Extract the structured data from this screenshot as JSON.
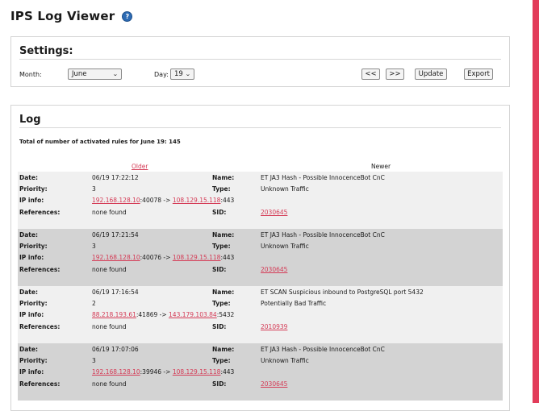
{
  "app": {
    "title": "IPS Log Viewer",
    "help_icon": "?"
  },
  "settings": {
    "title": "Settings:",
    "month_label": "Month:",
    "month_value": "June",
    "day_label": "Day:",
    "day_value": "19",
    "prev_button": "<<",
    "next_button": ">>",
    "update_button": "Update",
    "export_button": "Export"
  },
  "log": {
    "title": "Log",
    "total": "Total of number of activated rules for June 19: 145",
    "older_link": "Older",
    "newer_label": "Newer",
    "labels": {
      "date": "Date:",
      "priority": "Priority:",
      "ip_info": "IP info:",
      "references": "References:",
      "name": "Name:",
      "type": "Type:",
      "sid": "SID:"
    },
    "entries": [
      {
        "date": "06/19 17:22:12",
        "priority": "3",
        "src_ip": "192.168.128.10",
        "src_port": ":40078 ->",
        "dst_ip": "108.129.15.118",
        "dst_port": ":443",
        "references": "none found",
        "name": "ET JA3 Hash - Possible InnocenceBot CnC",
        "type": "Unknown Traffic",
        "sid": "2030645"
      },
      {
        "date": "06/19 17:21:54",
        "priority": "3",
        "src_ip": "192.168.128.10",
        "src_port": ":40076 ->",
        "dst_ip": "108.129.15.118",
        "dst_port": ":443",
        "references": "none found",
        "name": "ET JA3 Hash - Possible InnocenceBot CnC",
        "type": "Unknown Traffic",
        "sid": "2030645"
      },
      {
        "date": "06/19 17:16:54",
        "priority": "2",
        "src_ip": "88.218.193.61",
        "src_port": ":41869 ->",
        "dst_ip": "143.179.103.84",
        "dst_port": ":5432",
        "references": "none found",
        "name": "ET SCAN Suspicious inbound to PostgreSQL port 5432",
        "type": "Potentially Bad Traffic",
        "sid": "2010939"
      },
      {
        "date": "06/19 17:07:06",
        "priority": "3",
        "src_ip": "192.168.128.10",
        "src_port": ":39946 ->",
        "dst_ip": "108.129.15.118",
        "dst_port": ":443",
        "references": "none found",
        "name": "ET JA3 Hash - Possible InnocenceBot CnC",
        "type": "Unknown Traffic",
        "sid": "2030645"
      }
    ]
  }
}
